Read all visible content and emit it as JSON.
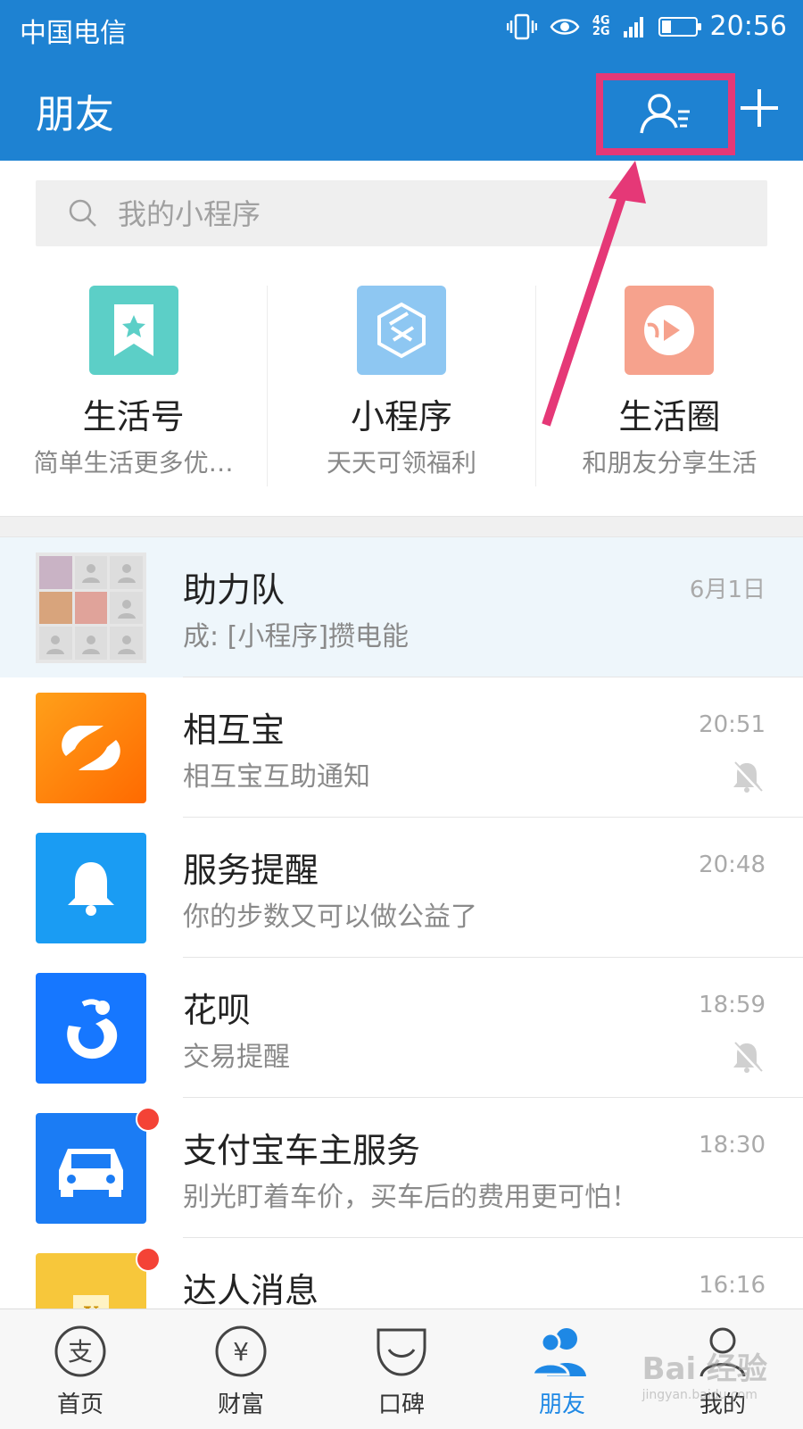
{
  "status_bar": {
    "carrier": "中国电信",
    "network": "4G 2G",
    "time": "20:56",
    "battery_level": 0.28
  },
  "header": {
    "title": "朋友"
  },
  "search": {
    "placeholder": "我的小程序"
  },
  "apps": [
    {
      "name": "生活号",
      "desc": "简单生活更多优…",
      "color": "#5ccfc7",
      "icon": "bookmark-star-icon"
    },
    {
      "name": "小程序",
      "desc": "天天可领福利",
      "color": "#8ec7f2",
      "icon": "mini-program-icon"
    },
    {
      "name": "生活圈",
      "desc": "和朋友分享生活",
      "color": "#f6a28d",
      "icon": "life-circle-icon"
    }
  ],
  "messages": [
    {
      "title": "助力队",
      "subtitle": "成: [小程序]攒电能",
      "time": "6月1日",
      "muted": false,
      "unread": false,
      "avatar": "group-avatar"
    },
    {
      "title": "相互宝",
      "subtitle": "相互宝互助通知",
      "time": "20:51",
      "muted": true,
      "unread": false,
      "avatar": "xianghubao-icon",
      "color": "#ff7a0a"
    },
    {
      "title": "服务提醒",
      "subtitle": "你的步数又可以做公益了",
      "time": "20:48",
      "muted": false,
      "unread": false,
      "avatar": "bell-icon",
      "color": "#1a9cf3"
    },
    {
      "title": "花呗",
      "subtitle": "交易提醒",
      "time": "18:59",
      "muted": true,
      "unread": false,
      "avatar": "huabei-icon",
      "color": "#1677ff"
    },
    {
      "title": "支付宝车主服务",
      "subtitle": "别光盯着车价，买车后的费用更可怕！",
      "time": "18:30",
      "muted": false,
      "unread": true,
      "avatar": "car-icon",
      "color": "#1b7cf4"
    },
    {
      "title": "达人消息",
      "subtitle": "",
      "time": "16:16",
      "muted": false,
      "unread": true,
      "avatar": "talent-icon",
      "color": "#f7c73b"
    }
  ],
  "tabs": [
    {
      "label": "首页",
      "icon": "home-alipay-icon",
      "active": false
    },
    {
      "label": "财富",
      "icon": "yuan-icon",
      "active": false
    },
    {
      "label": "口碑",
      "icon": "koubei-icon",
      "active": false
    },
    {
      "label": "朋友",
      "icon": "friends-icon",
      "active": true
    },
    {
      "label": "我的",
      "icon": "profile-icon",
      "active": false
    }
  ],
  "watermark": {
    "brand": "Bai 经验",
    "url": "jingyan.baidu.com"
  },
  "colors": {
    "header": "#1e82d2",
    "highlight": "#e53877",
    "active_tab": "#1e88e5"
  }
}
